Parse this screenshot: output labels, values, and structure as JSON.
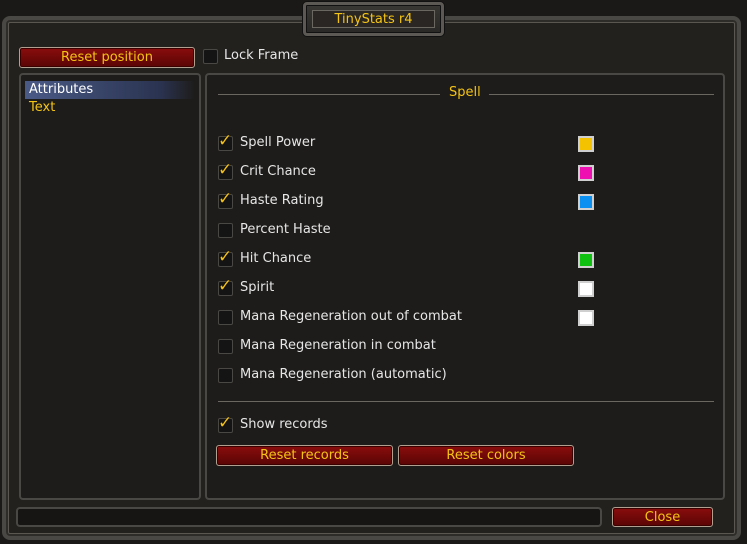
{
  "window": {
    "title": "TinyStats r4"
  },
  "top": {
    "reset_position_label": "Reset position",
    "lock_frame_label": "Lock Frame",
    "lock_frame_checked": false
  },
  "sidebar": {
    "items": [
      {
        "label": "Attributes",
        "selected": true
      },
      {
        "label": "Text",
        "selected": false
      }
    ]
  },
  "section": {
    "title": "Spell"
  },
  "options": [
    {
      "label": "Spell Power",
      "checked": true,
      "color": "#f5c200"
    },
    {
      "label": "Crit Chance",
      "checked": true,
      "color": "#ee10b0"
    },
    {
      "label": "Haste Rating",
      "checked": true,
      "color": "#0a90f0"
    },
    {
      "label": "Percent Haste",
      "checked": false,
      "color": null
    },
    {
      "label": "Hit Chance",
      "checked": true,
      "color": "#10c010"
    },
    {
      "label": "Spirit",
      "checked": true,
      "color": "#ffffff"
    },
    {
      "label": "Mana Regeneration out of combat",
      "checked": false,
      "color": "#ffffff"
    },
    {
      "label": "Mana Regeneration in combat",
      "checked": false,
      "color": null
    },
    {
      "label": "Mana Regeneration (automatic)",
      "checked": false,
      "color": null
    }
  ],
  "records": {
    "show_records_label": "Show records",
    "show_records_checked": true,
    "reset_records_label": "Reset records",
    "reset_colors_label": "Reset colors"
  },
  "footer": {
    "close_label": "Close"
  }
}
